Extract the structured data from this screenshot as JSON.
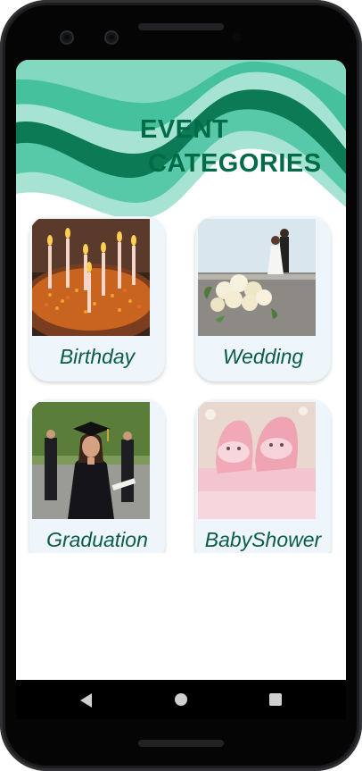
{
  "header": {
    "title_line1": "EVENT",
    "title_line2": "CATEGORIES"
  },
  "categories": [
    {
      "label": "Birthday",
      "image": "birthday-cake-candles"
    },
    {
      "label": "Wedding",
      "image": "wedding-bouquet-couple"
    },
    {
      "label": "Graduation",
      "image": "graduate-cap-gown"
    },
    {
      "label": "BabyShower",
      "image": "pink-baby-booties"
    }
  ],
  "navigation": {
    "back": "back-icon",
    "home": "home-icon",
    "recents": "recents-icon"
  },
  "colors": {
    "accent": "#006b47",
    "wave_light": "#a6e3d3",
    "wave_mid": "#57c9a8",
    "wave_dark": "#0c7a55",
    "card_bg": "#eef5fb",
    "label_text": "#0a5c48"
  }
}
